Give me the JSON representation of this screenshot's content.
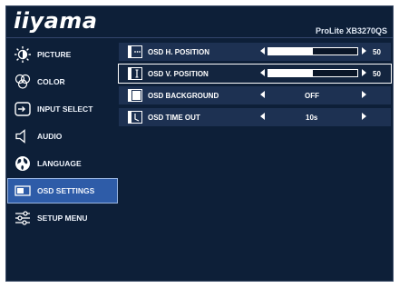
{
  "header": {
    "brand": "iiyama",
    "model": "ProLite XB3270QS"
  },
  "sidebar": {
    "items": [
      {
        "label": "PICTURE",
        "icon": "brightness-icon"
      },
      {
        "label": "COLOR",
        "icon": "color-icon"
      },
      {
        "label": "INPUT SELECT",
        "icon": "input-icon"
      },
      {
        "label": "AUDIO",
        "icon": "speaker-icon"
      },
      {
        "label": "LANGUAGE",
        "icon": "globe-icon"
      },
      {
        "label": "OSD SETTINGS",
        "icon": "osd-icon",
        "active": true
      },
      {
        "label": "SETUP MENU",
        "icon": "sliders-icon"
      }
    ]
  },
  "settings": {
    "rows": [
      {
        "label": "OSD H. POSITION",
        "value": "50",
        "level": 0.5
      },
      {
        "label": "OSD V. POSITION",
        "value": "50",
        "level": 0.5,
        "selected": true
      },
      {
        "label": "OSD BACKGROUND",
        "value": "OFF"
      },
      {
        "label": "OSD TIME OUT",
        "value": "10s"
      }
    ]
  },
  "colors": {
    "panel_bg": "#0d1f38",
    "row_bg": "#1d3152",
    "active_item": "#2e5ca8"
  }
}
